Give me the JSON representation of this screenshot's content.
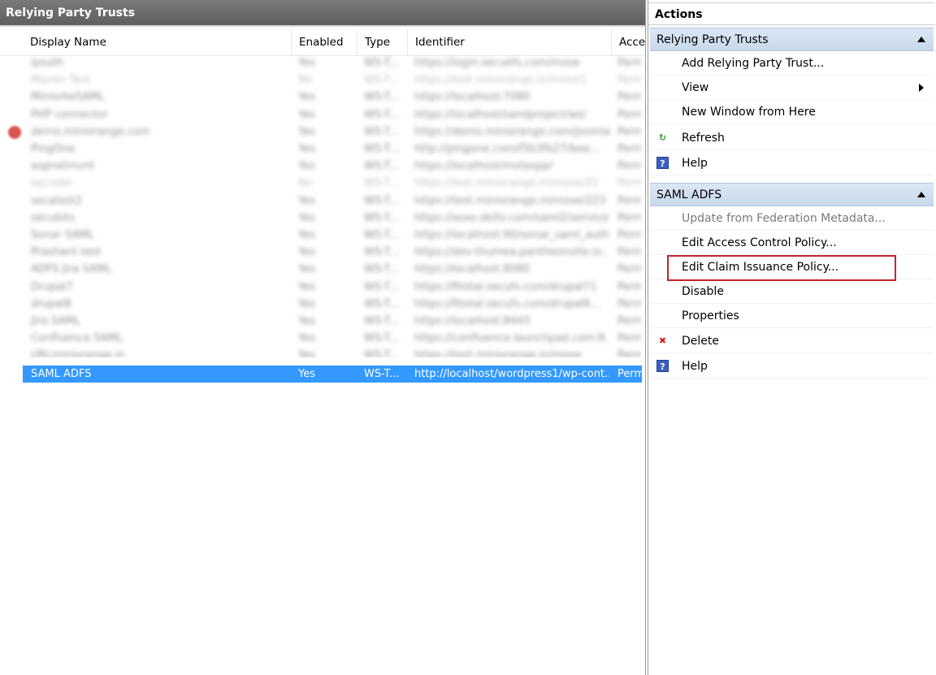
{
  "left_panel": {
    "title": "Relying Party Trusts",
    "columns": [
      "Display Name",
      "Enabled",
      "Type",
      "Identifier",
      "Acce"
    ],
    "blurred_rows": [
      {
        "name": "ipsuth",
        "enabled": "Yes",
        "type": "WS-T...",
        "identifier": "https://login.secuefs.com/mose",
        "access": "Perm"
      },
      {
        "name": "Maven Test",
        "enabled": "No",
        "type": "WS-T...",
        "identifier": "https://test.mmorange.m/mose1",
        "access": "Perm"
      },
      {
        "name": "MiniorkeSAML",
        "enabled": "Yes",
        "type": "WS-T...",
        "identifier": "https://localhost:7080",
        "access": "Perm"
      },
      {
        "name": "PHP connector",
        "enabled": "Yes",
        "type": "WS-T...",
        "identifier": "https://localhost/samlproject/ws/",
        "access": "Perm"
      },
      {
        "name": "demo.miniorange.com",
        "enabled": "Yes",
        "type": "WS-T...",
        "identifier": "https://demo.miniorange.com/joomla...",
        "access": "Perm"
      },
      {
        "name": "PingOne",
        "enabled": "Yes",
        "type": "WS-T...",
        "identifier": "http://pingone.com/f5b3fb27/bee...",
        "access": "Perm"
      },
      {
        "name": "aspnetmvnt",
        "enabled": "Yes",
        "type": "WS-T...",
        "identifier": "https://localhost/mvtaspp/",
        "access": "Perm"
      },
      {
        "name": "secnder",
        "enabled": "No",
        "type": "WS-T...",
        "identifier": "https://test.miniorange.m/mose/22",
        "access": "Perm"
      },
      {
        "name": "secatest2",
        "enabled": "Yes",
        "type": "WS-T...",
        "identifier": "https://test.miniorange.m/mose/223",
        "access": "Perm"
      },
      {
        "name": "secubits",
        "enabled": "Yes",
        "type": "WS-T...",
        "identifier": "https://xoxo.skills.com/saml2/service...",
        "access": "Perm"
      },
      {
        "name": "Sonar SAML",
        "enabled": "Yes",
        "type": "WS-T...",
        "identifier": "https://localhost:90/sonar_saml_auth",
        "access": "Perm"
      },
      {
        "name": "Prashant test",
        "enabled": "Yes",
        "type": "WS-T...",
        "identifier": "https://dev-thumea.pantheonsite.io...",
        "access": "Perm"
      },
      {
        "name": "ADFS Jira SAML",
        "enabled": "Yes",
        "type": "WS-T...",
        "identifier": "https://localhost:8080",
        "access": "Perm"
      },
      {
        "name": "Drupal7",
        "enabled": "Yes",
        "type": "WS-T...",
        "identifier": "https://fttstal.secufs.com/drupal71",
        "access": "Perm"
      },
      {
        "name": "drupal8",
        "enabled": "Yes",
        "type": "WS-T...",
        "identifier": "https://fttstal.secufs.com/drupal8...",
        "access": "Perm"
      },
      {
        "name": "Jira SAML",
        "enabled": "Yes",
        "type": "WS-T...",
        "identifier": "https://localhost:8443",
        "access": "Perm"
      },
      {
        "name": "Confluence SAML",
        "enabled": "Yes",
        "type": "WS-T...",
        "identifier": "https://confluence.launchpad.com:8...",
        "access": "Perm"
      },
      {
        "name": "URLminiorange.in",
        "enabled": "Yes",
        "type": "WS-T...",
        "identifier": "https://test.miniorange.in/mose",
        "access": "Perm"
      }
    ],
    "selected_row": {
      "name": "SAML ADFS",
      "enabled": "Yes",
      "type": "WS-T...",
      "identifier": "http://localhost/wordpress1/wp-cont...",
      "access": "Perm"
    }
  },
  "actions_panel": {
    "title": "Actions",
    "sections": [
      {
        "header": "Relying Party Trusts",
        "items": [
          {
            "label": "Add Relying Party Trust...",
            "icon": "",
            "disabled": false,
            "submenu": false
          },
          {
            "label": "View",
            "icon": "",
            "disabled": false,
            "submenu": true
          },
          {
            "label": "New Window from Here",
            "icon": "",
            "disabled": false,
            "submenu": false
          },
          {
            "label": "Refresh",
            "icon": "refresh-icon",
            "disabled": false,
            "submenu": false
          },
          {
            "label": "Help",
            "icon": "help-icon",
            "disabled": false,
            "submenu": false
          }
        ]
      },
      {
        "header": "SAML ADFS",
        "items": [
          {
            "label": "Update from Federation Metadata...",
            "icon": "",
            "disabled": true,
            "submenu": false
          },
          {
            "label": "Edit Access Control Policy...",
            "icon": "",
            "disabled": false,
            "submenu": false
          },
          {
            "label": "Edit Claim Issuance Policy...",
            "icon": "",
            "disabled": false,
            "submenu": false,
            "highlighted": true
          },
          {
            "label": "Disable",
            "icon": "",
            "disabled": false,
            "submenu": false
          },
          {
            "label": "Properties",
            "icon": "",
            "disabled": false,
            "submenu": false
          },
          {
            "label": "Delete",
            "icon": "delete-icon",
            "disabled": false,
            "submenu": false
          },
          {
            "label": "Help",
            "icon": "help-icon",
            "disabled": false,
            "submenu": false
          }
        ]
      }
    ]
  },
  "colors": {
    "selection": "#3399ff",
    "section_header": "#c8d8ea",
    "highlight_box": "#c0272d",
    "title_bar": "#6a6a6a"
  }
}
